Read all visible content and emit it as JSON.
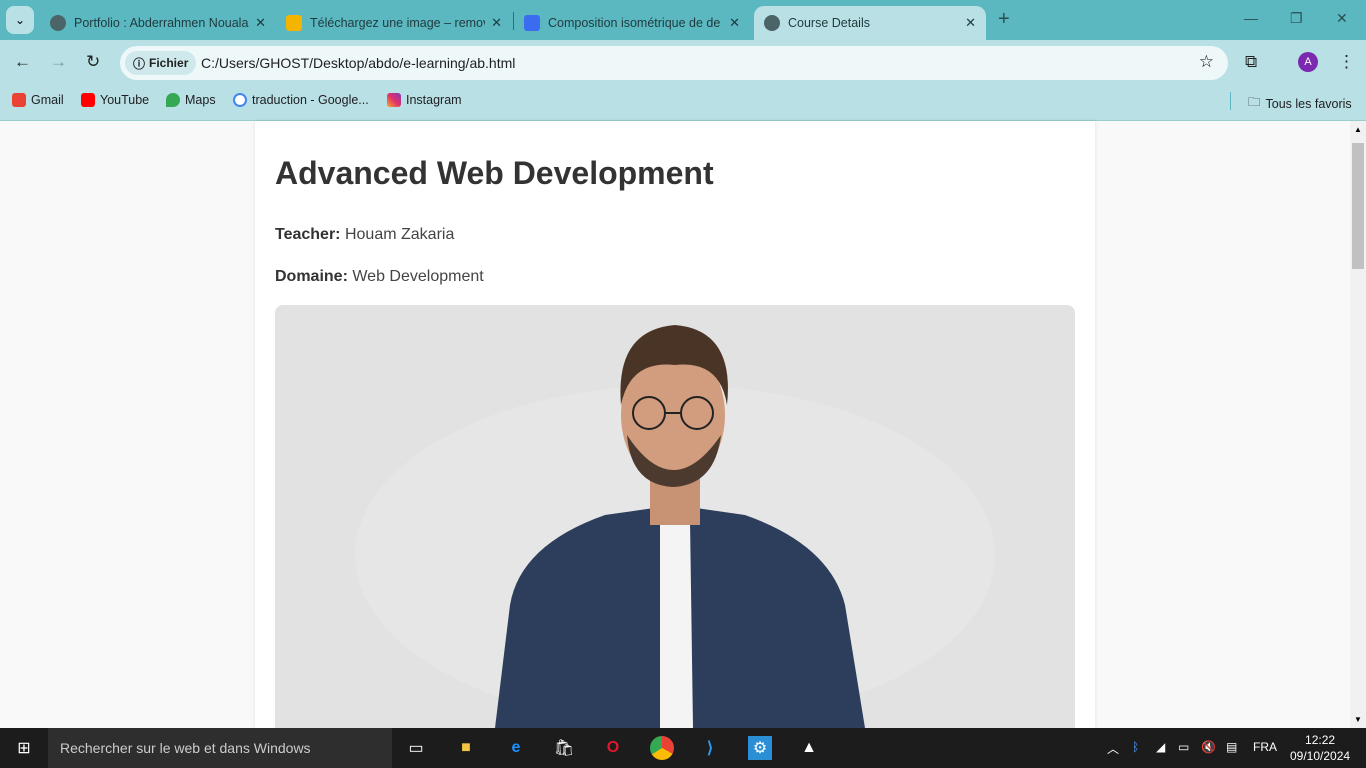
{
  "browser": {
    "tabs": [
      {
        "title": "Portfolio : Abderrahmen Nouala",
        "active": false
      },
      {
        "title": "Téléchargez une image – remove",
        "active": false
      },
      {
        "title": "Composition isométrique de de",
        "active": false
      },
      {
        "title": "Course Details",
        "active": true
      }
    ],
    "chip": "Fichier",
    "url": "C:/Users/GHOST/Desktop/abdo/e-learning/ab.html",
    "avatar": "A",
    "bookmarks": [
      "Gmail",
      "YouTube",
      "Maps",
      "traduction - Google...",
      "Instagram"
    ],
    "all_bookmarks": "Tous les favoris"
  },
  "course": {
    "title": "Advanced Web Development",
    "teacher_label": "Teacher:",
    "teacher": "Houam Zakaria",
    "domain_label": "Domaine:",
    "domain": "Web Development"
  },
  "taskbar": {
    "search_placeholder": "Rechercher sur le web et dans Windows",
    "lang": "FRA",
    "time": "12:22",
    "date": "09/10/2024"
  }
}
